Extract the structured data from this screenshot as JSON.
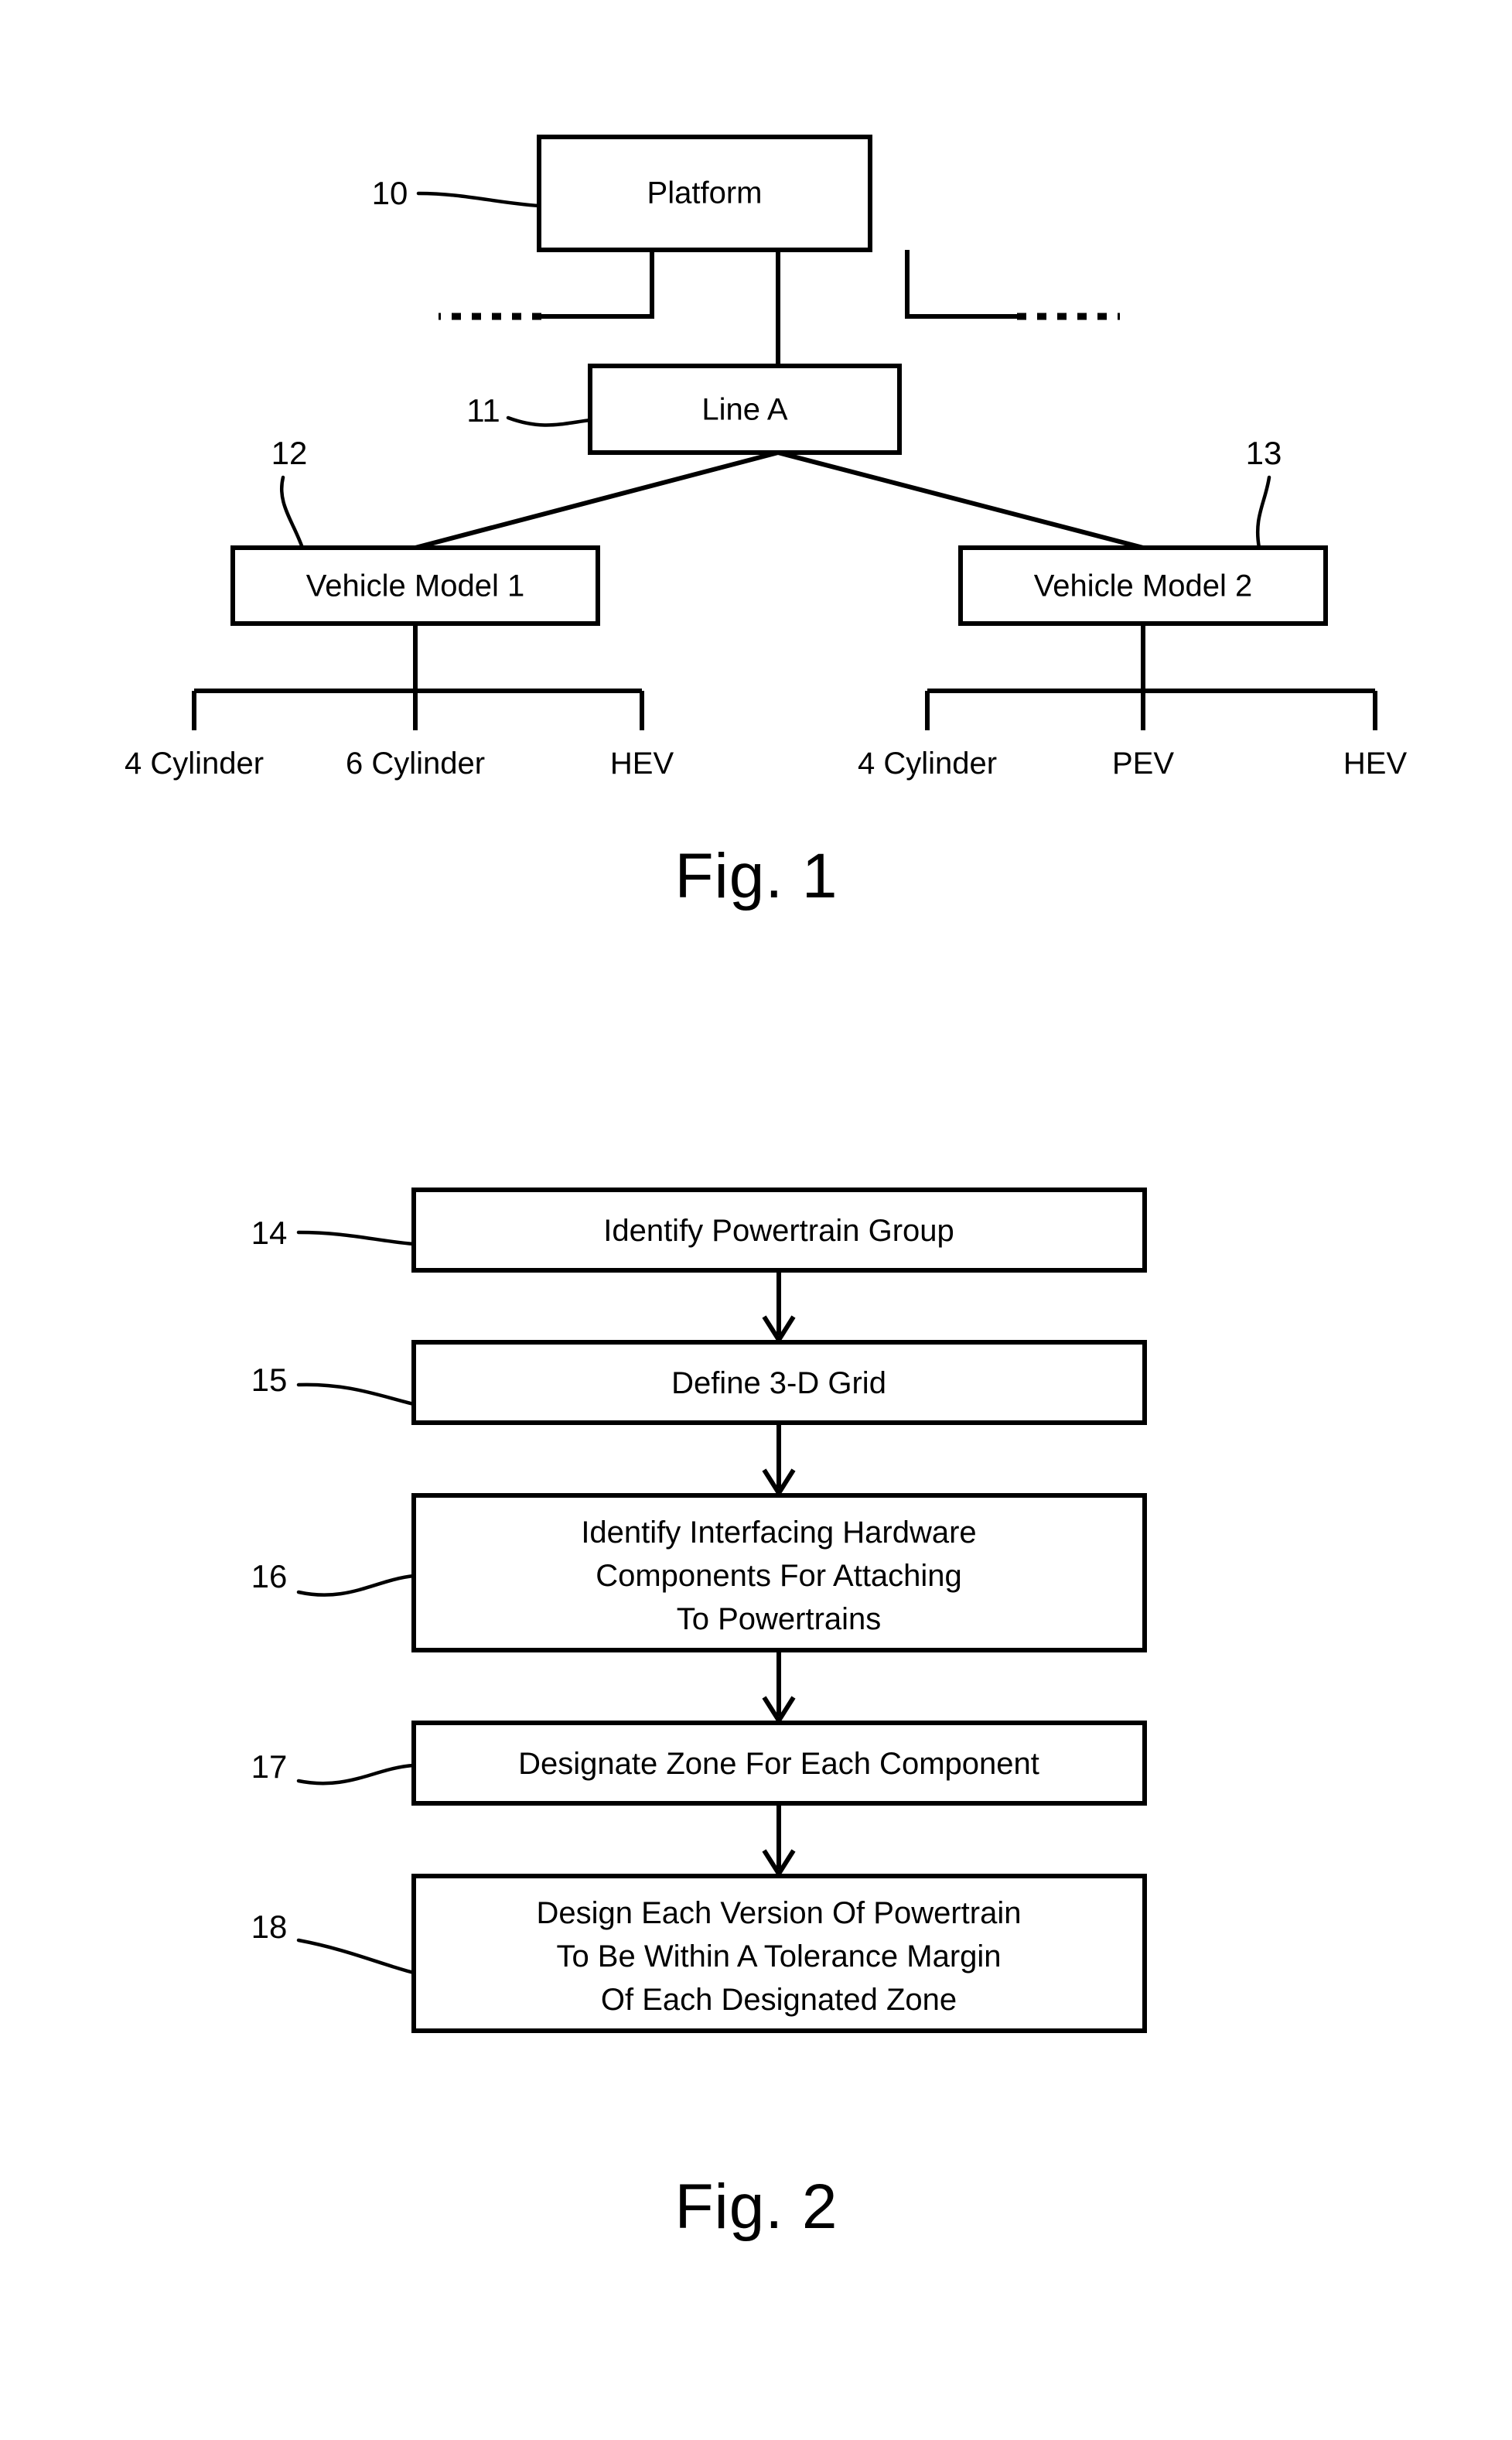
{
  "document": {
    "type": "patent-drawing-sheet",
    "background_color": "#ffffff",
    "line_color": "#000000"
  },
  "figure1": {
    "caption": "Fig. 1",
    "nodes": {
      "platform": {
        "label": "Platform",
        "ref": "10"
      },
      "line_a": {
        "label": "Line A",
        "ref": "11"
      },
      "vehicle_model_1": {
        "label": "Vehicle Model 1",
        "ref": "12"
      },
      "vehicle_model_2": {
        "label": "Vehicle Model 2",
        "ref": "13"
      }
    },
    "model1_variants": [
      "4 Cylinder",
      "6 Cylinder",
      "HEV"
    ],
    "model2_variants": [
      "4 Cylinder",
      "PEV",
      "HEV"
    ]
  },
  "figure2": {
    "caption": "Fig. 2",
    "steps": [
      {
        "ref": "14",
        "lines": [
          "Identify Powertrain Group"
        ]
      },
      {
        "ref": "15",
        "lines": [
          "Define 3-D Grid"
        ]
      },
      {
        "ref": "16",
        "lines": [
          "Identify Interfacing Hardware",
          "Components For Attaching",
          "To Powertrains"
        ]
      },
      {
        "ref": "17",
        "lines": [
          "Designate Zone For Each Component"
        ]
      },
      {
        "ref": "18",
        "lines": [
          "Design Each Version Of Powertrain",
          "To Be Within A Tolerance Margin",
          "Of Each Designated Zone"
        ]
      }
    ]
  }
}
